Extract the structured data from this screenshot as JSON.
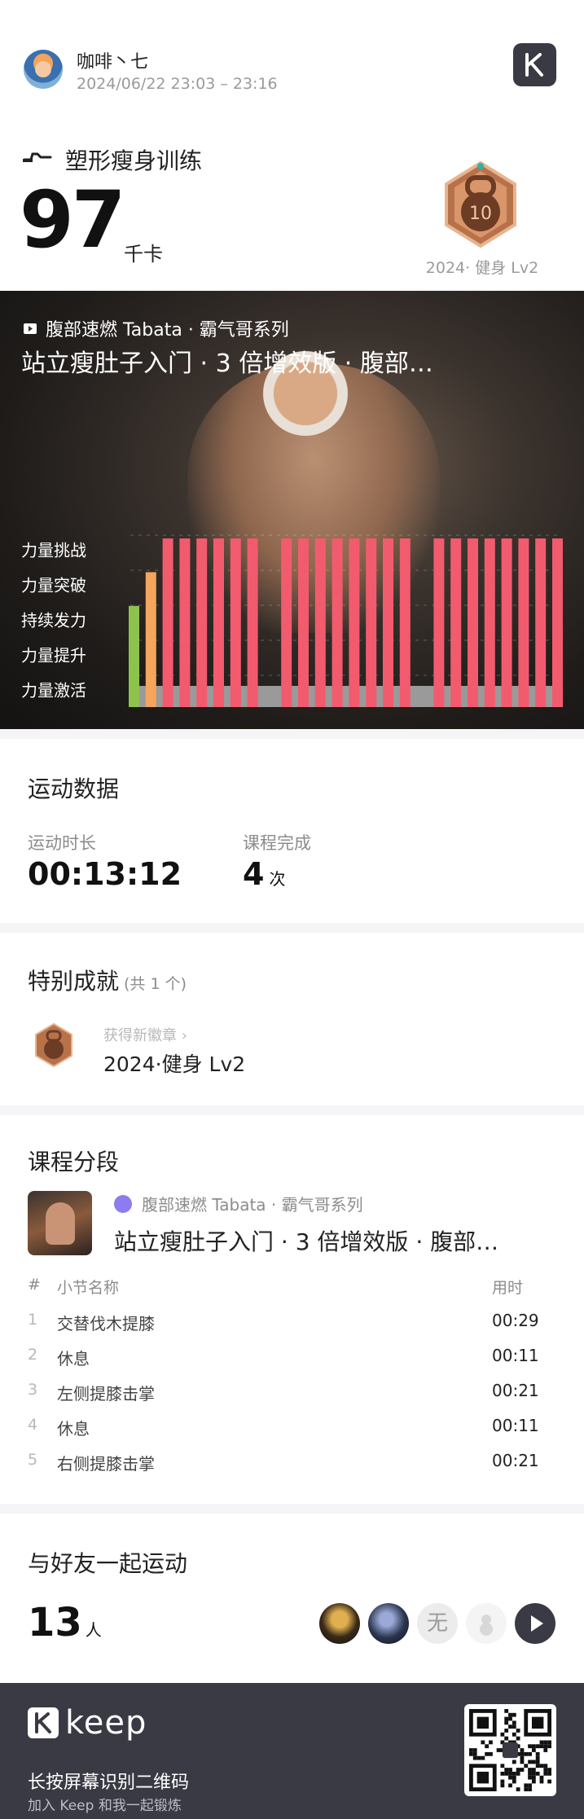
{
  "user": {
    "name": "咖啡丶七",
    "time_range": "2024/06/22 23:03 – 23:16"
  },
  "header": {
    "logo_icon": "keep-k-icon",
    "workout_icon": "fitness-icon"
  },
  "workout": {
    "title": "塑形瘦身训练",
    "calories": "97",
    "calories_unit": "千卡"
  },
  "medal": {
    "number": "10",
    "caption": "2024· 健身 Lv2"
  },
  "hero": {
    "series": "腹部速燃 Tabata · 霸气哥系列",
    "title": "站立瘦肚子入门 · 3 倍增效版 · 腹部…"
  },
  "chart_data": {
    "type": "bar",
    "ylabels": [
      "力量挑战",
      "力量突破",
      "持续发力",
      "力量提升",
      "力量激活"
    ],
    "levels_order_low_to_high": [
      "力量激活",
      "力量提升",
      "持续发力",
      "力量突破",
      "力量挑战"
    ],
    "values": [
      3,
      4,
      5,
      5,
      5,
      5,
      5,
      5,
      0,
      5,
      5,
      5,
      5,
      5,
      5,
      5,
      5,
      0,
      5,
      5,
      5,
      5,
      5,
      5,
      5,
      5,
      0
    ],
    "ylim": [
      0,
      5
    ],
    "colors": {
      "level5": "#f25b6e",
      "level4": "#f5a55c",
      "level3": "#8dc24d",
      "base": "#9a9a9a"
    },
    "grid": true
  },
  "stats": {
    "title": "运动数据",
    "duration_label": "运动时长",
    "duration_value": "00:13:12",
    "completion_label": "课程完成",
    "completion_value": "4",
    "completion_unit": "次"
  },
  "achievements": {
    "title": "特别成就",
    "count": "(共 1 个)",
    "sub": "获得新徽章 ›",
    "name": "2024·健身 Lv2"
  },
  "course": {
    "title": "课程分段",
    "series": "腹部速燃 Tabata · 霸气哥系列",
    "name": "站立瘦肚子入门 · 3 倍增效版 · 腹部…",
    "col_index": "#",
    "col_name": "小节名称",
    "col_time": "用时",
    "rows": [
      {
        "idx": "1",
        "name": "交替伐木提膝",
        "time": "00:29"
      },
      {
        "idx": "2",
        "name": "休息",
        "time": "00:11"
      },
      {
        "idx": "3",
        "name": "左侧提膝击掌",
        "time": "00:21"
      },
      {
        "idx": "4",
        "name": "休息",
        "time": "00:11"
      },
      {
        "idx": "5",
        "name": "右侧提膝击掌",
        "time": "00:21"
      }
    ]
  },
  "friends": {
    "title": "与好友一起运动",
    "count": "13",
    "unit": "人",
    "none_label": "无"
  },
  "footer": {
    "wordmark": "keep",
    "cta": "长按屏幕识别二维码",
    "sub": "加入 Keep 和我一起锻炼"
  }
}
